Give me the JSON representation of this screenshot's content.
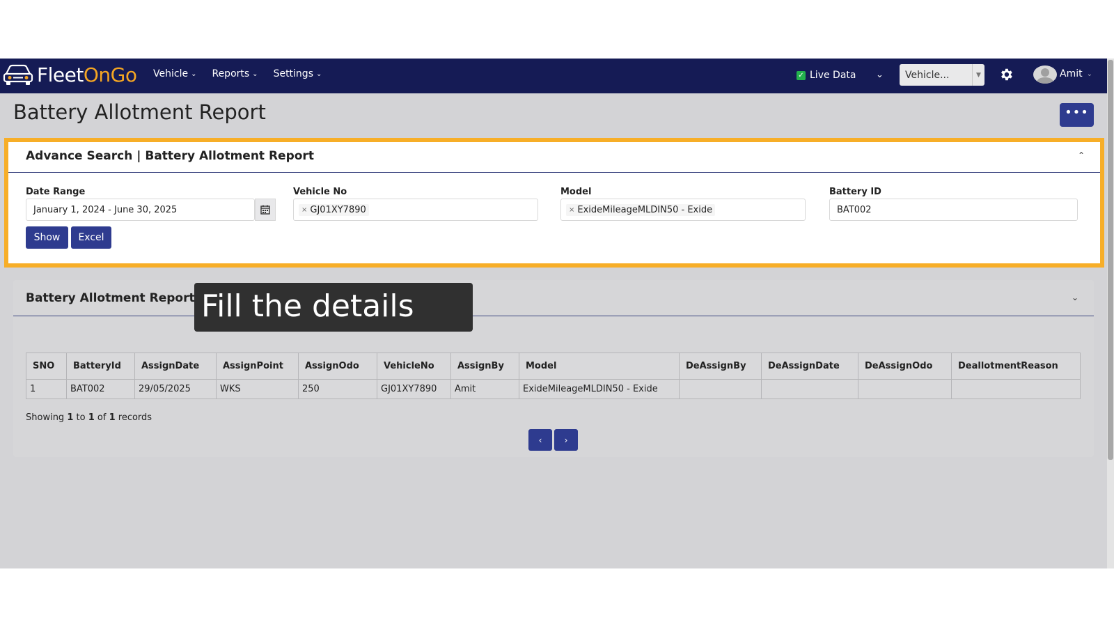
{
  "app": {
    "logo_part1": "Fleet",
    "logo_part2": "On",
    "logo_part3": "Go"
  },
  "nav": {
    "items": [
      {
        "label": "Vehicle"
      },
      {
        "label": "Reports"
      },
      {
        "label": "Settings"
      }
    ],
    "live_data": "Live Data",
    "vehicle_select": "Vehicle...",
    "user": "Amit"
  },
  "page": {
    "title": "Battery Allotment Report",
    "more": "•••"
  },
  "search": {
    "title": "Advance Search | Battery Allotment Report",
    "date_range_label": "Date Range",
    "date_range_value": "January 1, 2024 - June 30, 2025",
    "vehicle_label": "Vehicle No",
    "vehicle_tag": "GJ01XY7890",
    "model_label": "Model",
    "model_tag": "ExideMileageMLDIN50 - Exide",
    "battery_label": "Battery ID",
    "battery_value": "BAT002",
    "show_label": "Show",
    "excel_label": "Excel"
  },
  "report": {
    "title": "Battery Allotment Report",
    "columns": [
      "SNO",
      "BatteryId",
      "AssignDate",
      "AssignPoint",
      "AssignOdo",
      "VehicleNo",
      "AssignBy",
      "Model",
      "DeAssignBy",
      "DeAssignDate",
      "DeAssignOdo",
      "DeallotmentReason"
    ],
    "rows": [
      [
        "1",
        "BAT002",
        "29/05/2025",
        "WKS",
        "250",
        "GJ01XY7890",
        "Amit",
        "ExideMileageMLDIN50 - Exide",
        "",
        "",
        "",
        ""
      ]
    ],
    "showing_prefix": "Showing",
    "showing_from": "1",
    "showing_to_word": "to",
    "showing_to": "1",
    "showing_of_word": "of",
    "showing_total": "1",
    "showing_suffix": "records",
    "prev": "‹",
    "next": "›"
  },
  "tooltip": {
    "text": "Fill the details"
  },
  "colors": {
    "navbar": "#151b55",
    "accent_button": "#2e3b8f",
    "highlight": "#f7ae28",
    "logo_orange": "#f5a623"
  }
}
